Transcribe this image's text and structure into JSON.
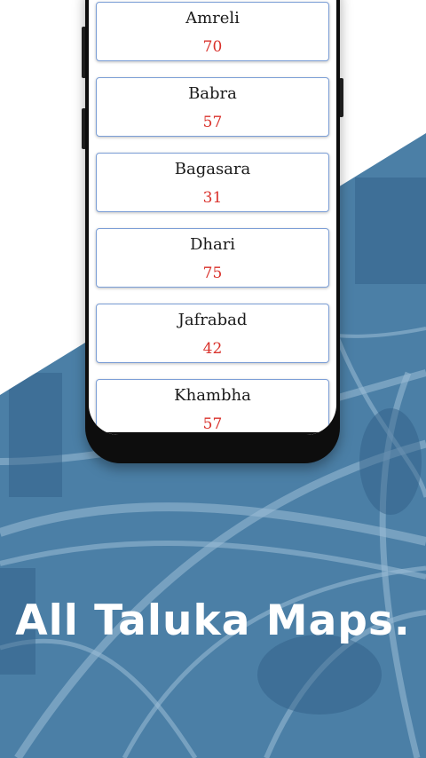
{
  "headline": "All Taluka Maps.",
  "colors": {
    "background_blue": "#4b7fa6",
    "card_border": "#7b9ed6",
    "count_red": "#d9312b",
    "phone_frame": "#0d0d0d"
  },
  "talukas": [
    {
      "name": "Amreli",
      "count": "70"
    },
    {
      "name": "Babra",
      "count": "57"
    },
    {
      "name": "Bagasara",
      "count": "31"
    },
    {
      "name": "Dhari",
      "count": "75"
    },
    {
      "name": "Jafrabad",
      "count": "42"
    },
    {
      "name": "Khambha",
      "count": "57"
    }
  ]
}
